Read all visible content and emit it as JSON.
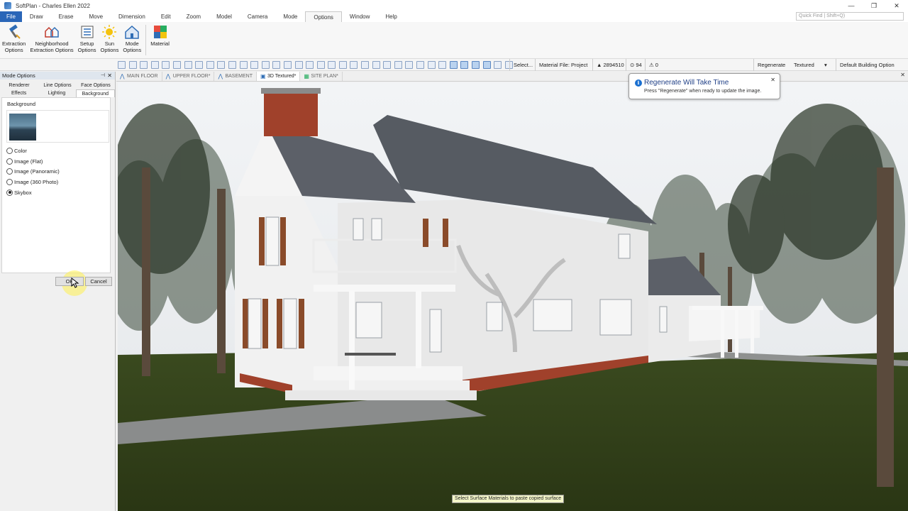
{
  "window": {
    "title": "SoftPlan - Charles Ellen 2022",
    "controls": [
      "—",
      "❐",
      "✕"
    ]
  },
  "menu": {
    "items": [
      "File",
      "Draw",
      "Erase",
      "Move",
      "Dimension",
      "Edit",
      "Zoom",
      "Model",
      "Camera",
      "Mode",
      "Options",
      "Window",
      "Help"
    ],
    "active": "Options",
    "quick_find_placeholder": "Quick Find | Shift+Q)"
  },
  "ribbon": {
    "buttons": [
      {
        "label": "Extraction\nOptions",
        "icon": "hammer-icon"
      },
      {
        "label": "Neighborhood\nExtraction Options",
        "icon": "neighborhood-icon"
      },
      {
        "label": "Setup\nOptions",
        "icon": "setup-list-icon"
      },
      {
        "label": "Sun\nOptions",
        "icon": "sun-icon"
      },
      {
        "label": "Mode\nOptions",
        "icon": "house-icon"
      },
      {
        "label": "Material",
        "icon": "material-icon"
      }
    ]
  },
  "toolbar": {
    "select_label": "Select...",
    "material_file": "Material File: Project",
    "count_a": "▲ 2894510",
    "count_b": "⊙ 94",
    "count_c": "⚠ 0",
    "regenerate_label": "Regenerate",
    "render_mode": "Textured",
    "building_option": "Default Building Option"
  },
  "mode_options": {
    "title": "Mode Options",
    "tabs_row1": [
      "Renderer",
      "Line Options",
      "Face Options"
    ],
    "tabs_row2": [
      "Effects",
      "Lighting",
      "Background"
    ],
    "active_tab": "Background",
    "group_label": "Background",
    "options": [
      "Color",
      "Image (Flat)",
      "Image (Panoramic)",
      "Image (360 Photo)",
      "Skybox"
    ],
    "selected_option": "Skybox",
    "ok_label": "OK",
    "cancel_label": "Cancel"
  },
  "view_tabs": {
    "tabs": [
      "MAIN FLOOR",
      "UPPER FLOOR*",
      "BASEMENT",
      "3D Textured*",
      "SITE PLAN*"
    ],
    "active": "3D Textured*"
  },
  "notification": {
    "title": "Regenerate Will Take Time",
    "message": "Press \"Regenerate\" when ready to update the image."
  },
  "status_tip": "Select Surface Materials to paste copied surface",
  "colors": {
    "accent": "#2a66b8",
    "grass": "#2c3a18",
    "brick": "#a0412b",
    "roof": "#5c6068",
    "siding": "#f2f2f2",
    "shutter": "#8a4b2a"
  }
}
